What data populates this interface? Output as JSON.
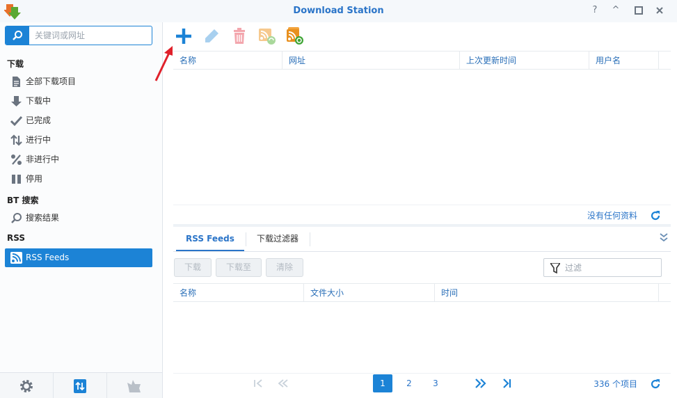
{
  "window": {
    "title": "Download Station",
    "controls": {
      "help": "?",
      "minimize": "^"
    }
  },
  "sidebar": {
    "search_placeholder": "关键词或网址",
    "sections": {
      "download": "下载",
      "bt_search": "BT 搜索",
      "rss": "RSS"
    },
    "items": [
      {
        "label": "全部下载项目",
        "icon": "document-icon"
      },
      {
        "label": "下载中",
        "icon": "arrow-down-icon"
      },
      {
        "label": "已完成",
        "icon": "checkmark-icon"
      },
      {
        "label": "进行中",
        "icon": "up-down-arrows-icon"
      },
      {
        "label": "非进行中",
        "icon": "percent-icon"
      },
      {
        "label": "停用",
        "icon": "pause-icon"
      },
      {
        "label": "搜索结果",
        "icon": "search-icon"
      },
      {
        "label": "RSS Feeds",
        "icon": "rss-icon",
        "active": true
      }
    ],
    "footer": [
      "gear-icon",
      "transfer-icon",
      "emule-icon"
    ]
  },
  "toolbar": {
    "buttons": [
      "add-icon",
      "edit-icon",
      "delete-icon",
      "rss-refresh-icon",
      "rss-update-all-icon"
    ]
  },
  "feeds_grid": {
    "columns": [
      "名称",
      "网址",
      "上次更新时间",
      "用户名"
    ],
    "status": "没有任何资料"
  },
  "bottom_panel": {
    "tabs": [
      "RSS Feeds",
      "下载过滤器"
    ],
    "active_tab": "RSS Feeds",
    "buttons": [
      "下载",
      "下载至",
      "清除"
    ],
    "filter_placeholder": "过滤",
    "columns": [
      "名称",
      "文件大小",
      "时间"
    ],
    "pager": {
      "pages": [
        "1",
        "2",
        "3"
      ],
      "current": "1",
      "count_text": "336 个项目"
    }
  },
  "colors": {
    "accent": "#1c83d6",
    "title": "#2a74c8",
    "annotation_arrow": "#e0212b"
  }
}
